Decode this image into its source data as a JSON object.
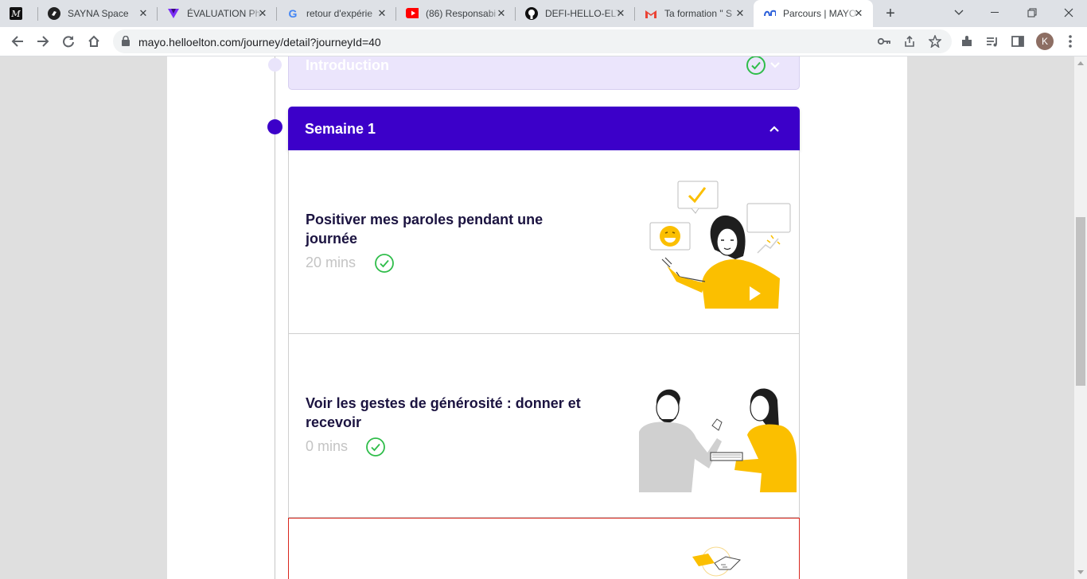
{
  "browser": {
    "tabs": [
      {
        "title": "",
        "icon": "medium-icon"
      },
      {
        "title": "SAYNA Space",
        "icon": "sayna-icon"
      },
      {
        "title": "ÉVALUATION Ph",
        "icon": "evaluation-icon"
      },
      {
        "title": "retour d'expérie",
        "icon": "google-icon"
      },
      {
        "title": "(86) Responsabi",
        "icon": "youtube-icon"
      },
      {
        "title": "DEFI-HELLO-ELT",
        "icon": "github-icon"
      },
      {
        "title": "Ta formation \" S",
        "icon": "gmail-icon"
      },
      {
        "title": "Parcours | MAYO",
        "icon": "mayo-icon",
        "active": true
      }
    ],
    "new_tab": "+",
    "url": "mayo.helloelton.com/journey/detail?journeyId=40",
    "profile_initial": "K"
  },
  "journey": {
    "sections": [
      {
        "title": "Introduction",
        "state": "completed-collapsed"
      },
      {
        "title": "Semaine 1",
        "state": "expanded"
      }
    ],
    "lessons": [
      {
        "title": " Positiver mes paroles pendant une journée",
        "duration": "20 mins",
        "completed": true
      },
      {
        "title": "Voir les gestes de générosité : donner et recevoir",
        "duration": "0 mins",
        "completed": true
      }
    ]
  },
  "colors": {
    "primary": "#3c00c9",
    "intro_bg": "#ebe5fc",
    "check_green": "#2fbd4a",
    "accent_yellow": "#fbbf00",
    "title_dark": "#1b1340",
    "muted": "#c4c4c4"
  }
}
